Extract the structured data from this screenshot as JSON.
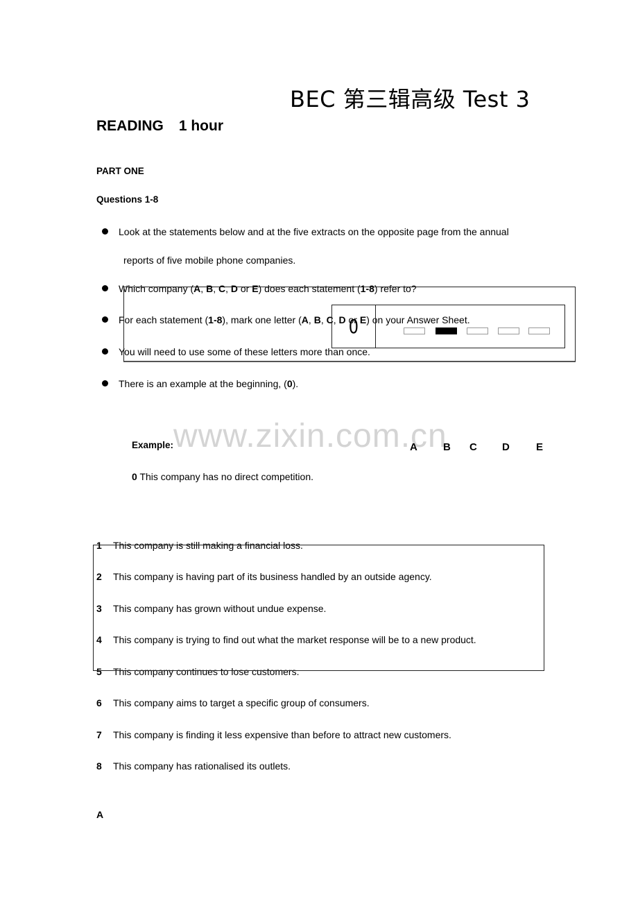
{
  "title": "BEC 第三辑高级 Test 3",
  "section": {
    "name": "READING",
    "duration": "1 hour"
  },
  "part": "PART ONE",
  "questions_range": "Questions 1-8",
  "instructions": {
    "line1a": "Look at the statements below and at the five extracts on the opposite page from the annual",
    "line1b": "reports of five mobile phone companies.",
    "line2": {
      "pre": "Which company (",
      "A": "A",
      "sep1": ", ",
      "B": "B",
      "sep2": ", ",
      "C": "C",
      "sep3": ", ",
      "D": "D",
      "or": " or ",
      "E": "E",
      "mid": ") does each statement (",
      "range": "1-8",
      "post": ") refer to?"
    },
    "line3": {
      "pre": "For each statement (",
      "range": "1-8",
      "mid": "), mark one letter (",
      "A": "A",
      "sep1": ", ",
      "B": "B",
      "sep2": ", ",
      "C": "C",
      "sep3": ", ",
      "D": "D",
      "or": " or ",
      "E": "E",
      "post": ") on your Answer Sheet."
    },
    "line4": "You will need to use some of these letters more than once.",
    "line5": {
      "pre": "There is an example at the beginning, (",
      "num": "0",
      "post": ")."
    }
  },
  "answer_sheet_sample": {
    "number": "0",
    "options": [
      "A",
      "B",
      "C",
      "D",
      "E"
    ],
    "selected": "B"
  },
  "watermark": "www.zixin.com.cn",
  "example": {
    "label": "Example:",
    "options": [
      "A",
      "B",
      "C",
      "D",
      "E"
    ],
    "number": "0",
    "text": "This company has no direct competition."
  },
  "statements": [
    {
      "num": "1",
      "text": "This company is still making a financial loss."
    },
    {
      "num": "2",
      "text": "This company is having part of its business handled by an outside agency."
    },
    {
      "num": "3",
      "text": "This company has grown without undue expense."
    },
    {
      "num": "4",
      "text": "This company is trying to find out what the market response will be to a new product."
    },
    {
      "num": "5",
      "text": "This company continues to lose customers."
    },
    {
      "num": "6",
      "text": "This company aims to target a specific group of consumers."
    },
    {
      "num": "7",
      "text": "This company is finding it less expensive than before to attract new customers."
    },
    {
      "num": "8",
      "text": "This company has rationalised its outlets."
    }
  ],
  "next_section_label": "A"
}
